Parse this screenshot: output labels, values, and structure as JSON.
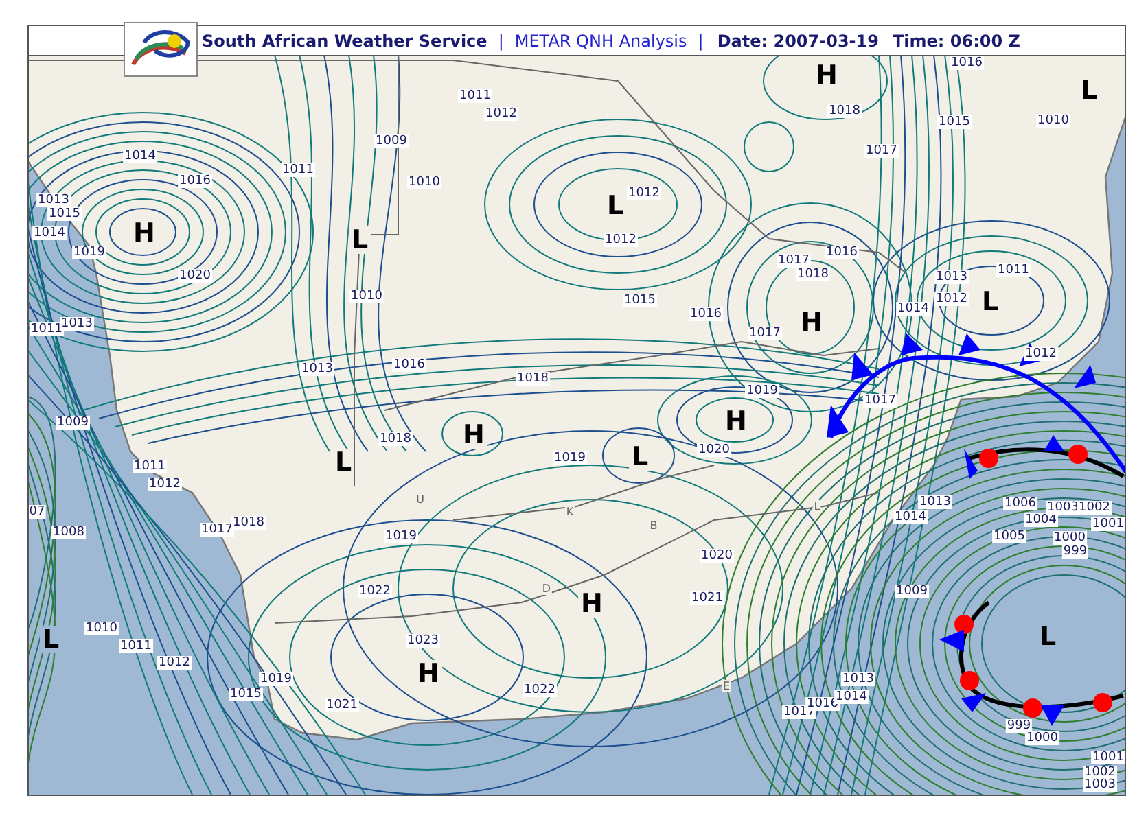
{
  "header": [
    {
      "kind": "org",
      "text": "South African Weather Service"
    },
    {
      "kind": "sep",
      "text": "|"
    },
    {
      "kind": "product",
      "text": "METAR QNH Analysis"
    },
    {
      "kind": "sep",
      "text": "|"
    },
    {
      "kind": "date",
      "text": "Date: 2007-03-19"
    },
    {
      "kind": "date",
      "text": "Time: 06:00 Z"
    }
  ],
  "map": {
    "pressure_centers": [
      {
        "text": "H"
      },
      {
        "text": "L"
      },
      {
        "text": "L"
      },
      {
        "text": "H"
      },
      {
        "text": "L"
      },
      {
        "text": "L"
      },
      {
        "text": "H"
      },
      {
        "text": "H"
      },
      {
        "text": "L"
      },
      {
        "text": "L"
      },
      {
        "text": "H"
      },
      {
        "text": "H"
      },
      {
        "text": "H"
      },
      {
        "text": "L"
      },
      {
        "text": "L"
      }
    ],
    "isobar_labels": [
      {
        "text": "1011"
      },
      {
        "text": "1012"
      },
      {
        "text": "1009"
      },
      {
        "text": "1010"
      },
      {
        "text": "1011"
      },
      {
        "text": "1014"
      },
      {
        "text": "1016"
      },
      {
        "text": "1013"
      },
      {
        "text": "1015"
      },
      {
        "text": "1014"
      },
      {
        "text": "1019"
      },
      {
        "text": "1020"
      },
      {
        "text": "1010"
      },
      {
        "text": "1011"
      },
      {
        "text": "1013"
      },
      {
        "text": "1013"
      },
      {
        "text": "1016"
      },
      {
        "text": "1012"
      },
      {
        "text": "1012"
      },
      {
        "text": "1015"
      },
      {
        "text": "1016"
      },
      {
        "text": "1017"
      },
      {
        "text": "1016"
      },
      {
        "text": "1018"
      },
      {
        "text": "1017"
      },
      {
        "text": "1018"
      },
      {
        "text": "1017"
      },
      {
        "text": "1016"
      },
      {
        "text": "1015"
      },
      {
        "text": "1010"
      },
      {
        "text": "1013"
      },
      {
        "text": "1011"
      },
      {
        "text": "1014"
      },
      {
        "text": "1012"
      },
      {
        "text": "1012"
      },
      {
        "text": "1018"
      },
      {
        "text": "1019"
      },
      {
        "text": "1017"
      },
      {
        "text": "1018"
      },
      {
        "text": "1019"
      },
      {
        "text": "1020"
      },
      {
        "text": "1009"
      },
      {
        "text": "1011"
      },
      {
        "text": "1012"
      },
      {
        "text": "07"
      },
      {
        "text": "1008"
      },
      {
        "text": "1017"
      },
      {
        "text": "1018"
      },
      {
        "text": "1019"
      },
      {
        "text": "1010"
      },
      {
        "text": "1011"
      },
      {
        "text": "1012"
      },
      {
        "text": "1015"
      },
      {
        "text": "1019"
      },
      {
        "text": "1021"
      },
      {
        "text": "1022"
      },
      {
        "text": "1023"
      },
      {
        "text": "1022"
      },
      {
        "text": "1020"
      },
      {
        "text": "1021"
      },
      {
        "text": "1017"
      },
      {
        "text": "1016"
      },
      {
        "text": "1013"
      },
      {
        "text": "1014"
      },
      {
        "text": "1009"
      },
      {
        "text": "1013"
      },
      {
        "text": "1014"
      },
      {
        "text": "1006"
      },
      {
        "text": "1004"
      },
      {
        "text": "1005"
      },
      {
        "text": "1003"
      },
      {
        "text": "1002"
      },
      {
        "text": "1001"
      },
      {
        "text": "1000"
      },
      {
        "text": "999"
      },
      {
        "text": "999"
      },
      {
        "text": "1000"
      },
      {
        "text": "1001"
      },
      {
        "text": "1002"
      },
      {
        "text": "1003"
      }
    ],
    "place_marks": [
      {
        "text": "U"
      },
      {
        "text": "K"
      },
      {
        "text": "B"
      },
      {
        "text": "D"
      },
      {
        "text": "E"
      },
      {
        "text": "L"
      }
    ]
  }
}
